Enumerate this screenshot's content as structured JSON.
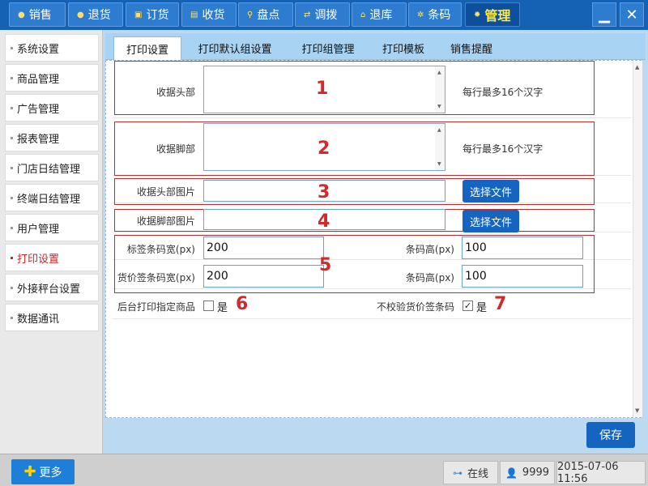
{
  "nav": {
    "items": [
      {
        "label": "销售",
        "icon": "circle-plus-icon"
      },
      {
        "label": "退货",
        "icon": "circle-minus-icon"
      },
      {
        "label": "订货",
        "icon": "order-icon"
      },
      {
        "label": "收货",
        "icon": "document-icon"
      },
      {
        "label": "盘点",
        "icon": "magnifier-icon"
      },
      {
        "label": "调拨",
        "icon": "transfer-icon"
      },
      {
        "label": "退库",
        "icon": "home-icon"
      },
      {
        "label": "条码",
        "icon": "barcode-icon"
      },
      {
        "label": "管理",
        "icon": "gear-icon",
        "active": true
      }
    ],
    "minimize_symbol": "▁",
    "close_symbol": "✕"
  },
  "sidebar": {
    "items": [
      {
        "label": "系统设置"
      },
      {
        "label": "商品管理"
      },
      {
        "label": "广告管理"
      },
      {
        "label": "报表管理"
      },
      {
        "label": "门店日结管理"
      },
      {
        "label": "终端日结管理"
      },
      {
        "label": "用户管理"
      },
      {
        "label": "打印设置",
        "active": true
      },
      {
        "label": "外接秤台设置"
      },
      {
        "label": "数据通讯"
      }
    ]
  },
  "tabs": [
    {
      "label": "打印设置",
      "active": true
    },
    {
      "label": "打印默认组设置"
    },
    {
      "label": "打印组管理"
    },
    {
      "label": "打印模板"
    },
    {
      "label": "销售提醒"
    }
  ],
  "form": {
    "receipt_header": {
      "label": "收据头部",
      "value": "",
      "hint": "每行最多16个汉字",
      "marker": "1"
    },
    "receipt_footer": {
      "label": "收据脚部",
      "value": "",
      "hint": "每行最多16个汉字",
      "marker": "2"
    },
    "header_image": {
      "label": "收据头部图片",
      "value": "",
      "button": "选择文件",
      "marker": "3"
    },
    "footer_image": {
      "label": "收据脚部图片",
      "value": "",
      "button": "选择文件",
      "marker": "4"
    },
    "label_barcode_width": {
      "label": "标签条码宽(px)",
      "value": "200"
    },
    "label_barcode_height": {
      "label": "条码高(px)",
      "value": "100"
    },
    "price_barcode_width": {
      "label": "货价签条码宽(px)",
      "value": "200"
    },
    "price_barcode_height": {
      "label": "条码高(px)",
      "value": "100"
    },
    "barcode_marker": "5",
    "backend_print": {
      "label": "后台打印指定商品",
      "option": "是",
      "checked": false,
      "marker": "6"
    },
    "skip_price_check": {
      "label": "不校验货价签条码",
      "option": "是",
      "checked": true,
      "marker": "7"
    },
    "save": "保存"
  },
  "footer": {
    "more": "更多",
    "online": "在线",
    "user": "9999",
    "datetime": "2015-07-06 11:56"
  },
  "colors": {
    "accent": "#1565c0",
    "marker_red": "#d12a2a",
    "topbar": "#1561b3"
  }
}
